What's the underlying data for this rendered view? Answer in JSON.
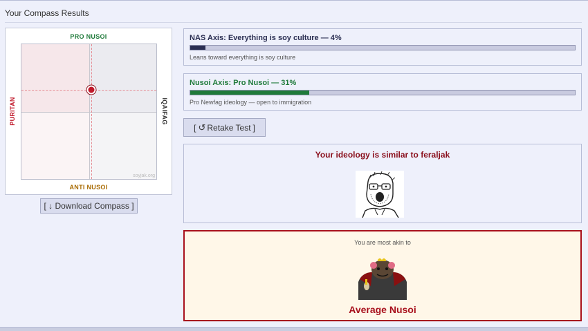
{
  "header": {
    "title": "Your Compass Results"
  },
  "compass": {
    "top_label": "PRO NUSOI",
    "bottom_label": "ANTI NUSOI",
    "left_label": "PURITAN",
    "right_label": "IQAIFAG",
    "watermark": "soyjak.org",
    "marker": {
      "x_fraction": 0.52,
      "y_fraction": 0.34
    },
    "download_button": "[ ↓ Download Compass ]"
  },
  "axes": [
    {
      "title": "NAS Axis: Everything is soy culture — 4%",
      "percent": 4,
      "description": "Leans toward everything is soy culture",
      "color": "#2a2e52"
    },
    {
      "title": "Nusoi Axis: Pro Nusoi — 31%",
      "percent": 31,
      "description": "Pro Newfag ideology — open to immigration",
      "color": "#1f7a3a"
    }
  ],
  "retake": {
    "pre": "[",
    "icon": "refresh-icon",
    "label": "Retake Test",
    "post": "]"
  },
  "similar": {
    "heading": "Your ideology is similar to feraljak"
  },
  "akin": {
    "pre": "You are most akin to",
    "name": "Average Nusoi"
  },
  "colors": {
    "accent": "#a8101c",
    "panel": "#eef0fb"
  }
}
